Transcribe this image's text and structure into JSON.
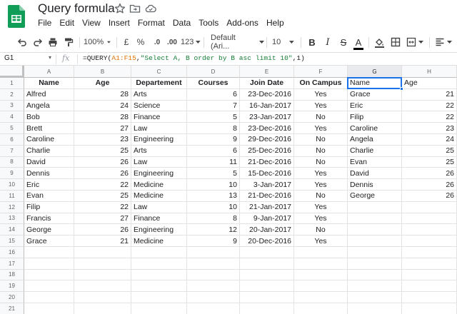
{
  "app": {
    "title": "Query formula",
    "menu": [
      "File",
      "Edit",
      "View",
      "Insert",
      "Format",
      "Data",
      "Tools",
      "Add-ons",
      "Help"
    ],
    "brand_color": "#0f9d58"
  },
  "toolbar": {
    "zoom": "100%",
    "currency": "£",
    "percent": "%",
    "dec_decrease": ".0",
    "dec_increase": ".00",
    "more_formats": "123",
    "font": "Default (Ari...",
    "font_size": "10",
    "bold": "B",
    "italic": "I",
    "strike": "S",
    "text_color": "A"
  },
  "formula_bar": {
    "cell_ref": "G1",
    "fx": "fx",
    "formula_prefix": "=QUERY(",
    "formula_range": "A1:F15",
    "formula_sep1": ",",
    "formula_query": "\"Select A, B order by B asc limit 10\"",
    "formula_suffix": ",1)"
  },
  "grid": {
    "columns": [
      "A",
      "B",
      "C",
      "D",
      "E",
      "F",
      "G",
      "H"
    ],
    "active_column": "G",
    "active_cell": "G1",
    "rows": [
      [
        "Name",
        "Age",
        "Departement",
        "Courses",
        "Join Date",
        "On Campus",
        "Name",
        "Age"
      ],
      [
        "Alfred",
        "28",
        "Arts",
        "6",
        "23-Dec-2016",
        "Yes",
        "Grace",
        "21"
      ],
      [
        "Angela",
        "24",
        "Science",
        "7",
        "16-Jan-2017",
        "Yes",
        "Eric",
        "22"
      ],
      [
        "Bob",
        "28",
        "Finance",
        "5",
        "23-Jan-2017",
        "No",
        "Filip",
        "22"
      ],
      [
        "Brett",
        "27",
        "Law",
        "8",
        "23-Dec-2016",
        "Yes",
        "Caroline",
        "23"
      ],
      [
        "Caroline",
        "23",
        "Engineering",
        "9",
        "29-Dec-2016",
        "No",
        "Angela",
        "24"
      ],
      [
        "Charlie",
        "25",
        "Arts",
        "6",
        "25-Dec-2016",
        "No",
        "Charlie",
        "25"
      ],
      [
        "David",
        "26",
        "Law",
        "11",
        "21-Dec-2016",
        "No",
        "Evan",
        "25"
      ],
      [
        "Dennis",
        "26",
        "Engineering",
        "5",
        "15-Dec-2016",
        "Yes",
        "David",
        "26"
      ],
      [
        "Eric",
        "22",
        "Medicine",
        "10",
        "3-Jan-2017",
        "Yes",
        "Dennis",
        "26"
      ],
      [
        "Evan",
        "25",
        "Medicine",
        "13",
        "21-Dec-2016",
        "No",
        "George",
        "26"
      ],
      [
        "Filip",
        "22",
        "Law",
        "10",
        "21-Jan-2017",
        "Yes",
        "",
        ""
      ],
      [
        "Francis",
        "27",
        "Finance",
        "8",
        "9-Jan-2017",
        "Yes",
        "",
        ""
      ],
      [
        "George",
        "26",
        "Engineering",
        "12",
        "20-Jan-2017",
        "No",
        "",
        ""
      ],
      [
        "Grace",
        "21",
        "Medicine",
        "9",
        "20-Dec-2016",
        "Yes",
        "",
        ""
      ],
      [
        "",
        "",
        "",
        "",
        "",
        "",
        "",
        ""
      ],
      [
        "",
        "",
        "",
        "",
        "",
        "",
        "",
        ""
      ],
      [
        "",
        "",
        "",
        "",
        "",
        "",
        "",
        ""
      ],
      [
        "",
        "",
        "",
        "",
        "",
        "",
        "",
        ""
      ],
      [
        "",
        "",
        "",
        "",
        "",
        "",
        "",
        ""
      ],
      [
        "",
        "",
        "",
        "",
        "",
        "",
        "",
        ""
      ]
    ]
  }
}
